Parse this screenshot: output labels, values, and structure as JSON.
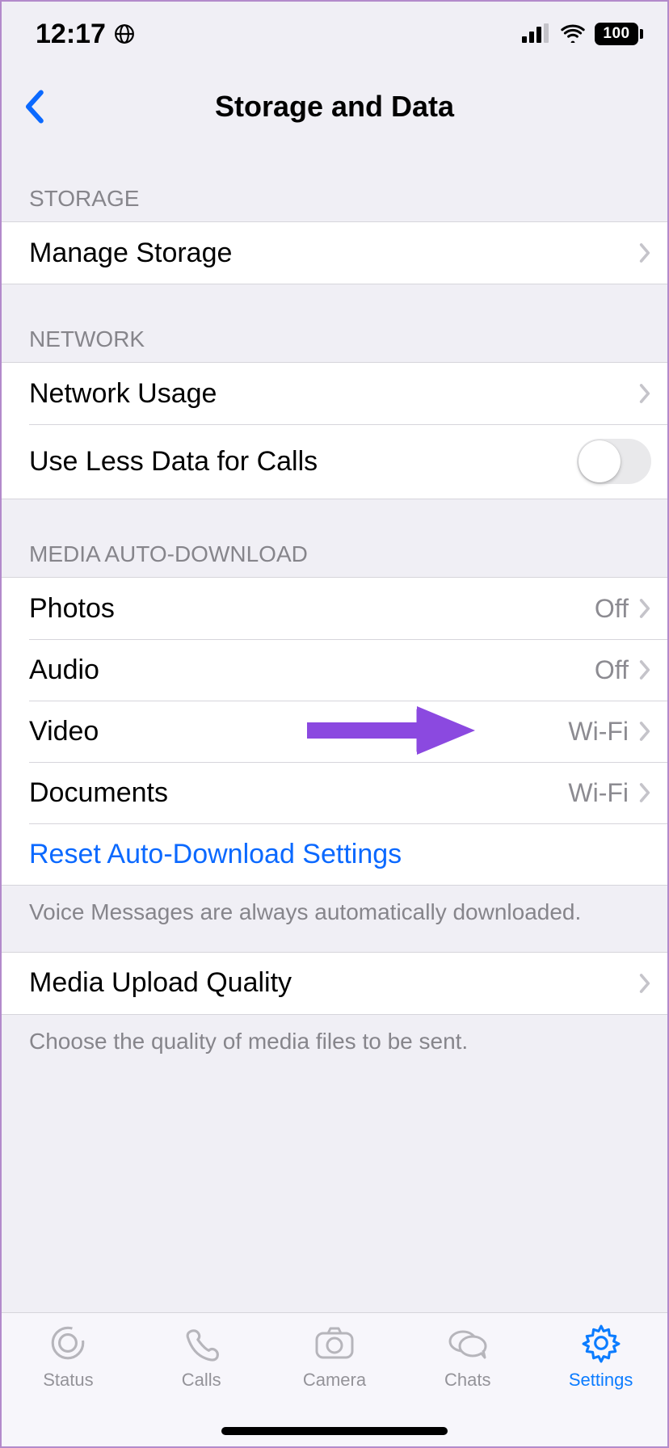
{
  "status_bar": {
    "time": "12:17",
    "battery": "100"
  },
  "nav": {
    "title": "Storage and Data"
  },
  "sections": {
    "storage": {
      "header": "STORAGE",
      "manage": "Manage Storage"
    },
    "network": {
      "header": "NETWORK",
      "usage": "Network Usage",
      "use_less": "Use Less Data for Calls"
    },
    "media": {
      "header": "MEDIA AUTO-DOWNLOAD",
      "photos": {
        "label": "Photos",
        "value": "Off"
      },
      "audio": {
        "label": "Audio",
        "value": "Off"
      },
      "video": {
        "label": "Video",
        "value": "Wi-Fi"
      },
      "documents": {
        "label": "Documents",
        "value": "Wi-Fi"
      },
      "reset": "Reset Auto-Download Settings",
      "footer": "Voice Messages are always automatically downloaded."
    },
    "upload": {
      "label": "Media Upload Quality",
      "footer": "Choose the quality of media files to be sent."
    }
  },
  "tabbar": {
    "status": "Status",
    "calls": "Calls",
    "camera": "Camera",
    "chats": "Chats",
    "settings": "Settings"
  }
}
